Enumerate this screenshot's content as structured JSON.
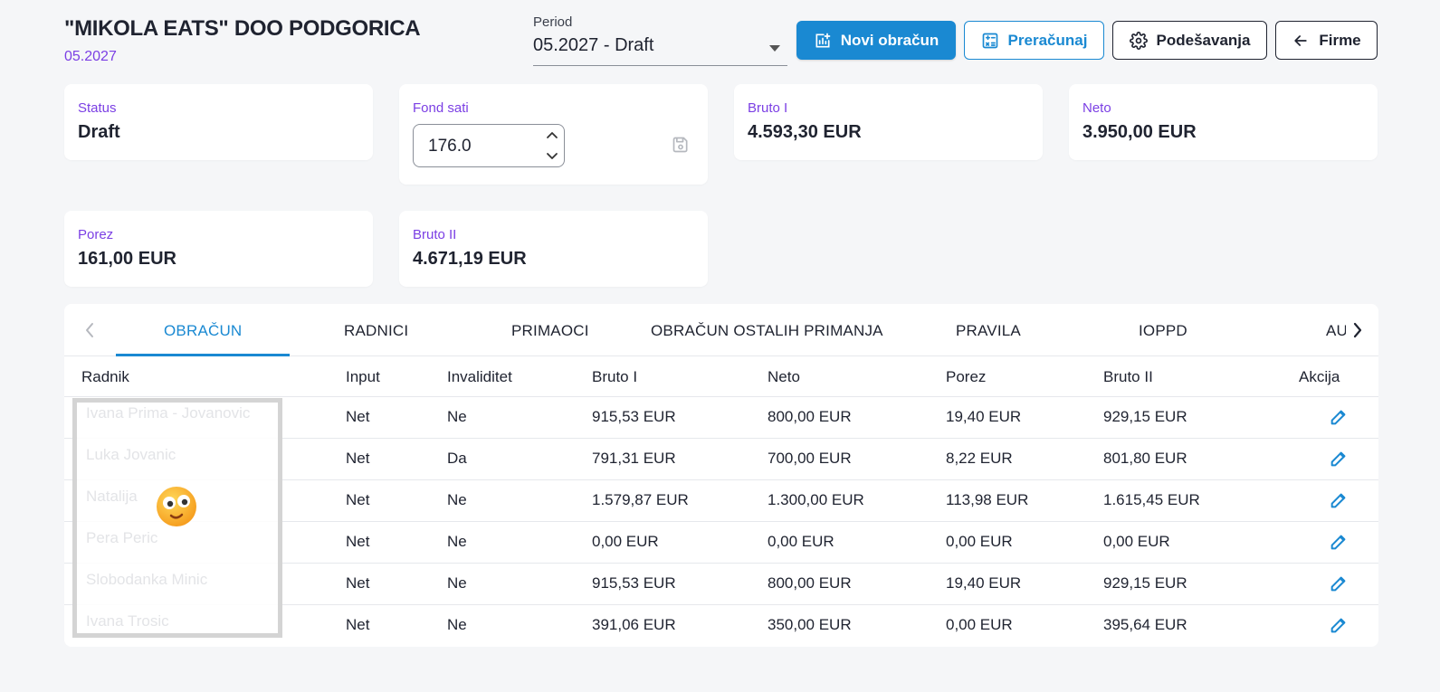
{
  "header": {
    "company": "\"MIKOLA EATS\" DOO PODGORICA",
    "period_sub": "05.2027"
  },
  "period_select": {
    "label": "Period",
    "value": "05.2027 - Draft"
  },
  "buttons": {
    "new_calc": "Novi obračun",
    "recalc": "Preračunaj",
    "settings": "Podešavanja",
    "back": "Firme"
  },
  "cards": {
    "status": {
      "label": "Status",
      "value": "Draft"
    },
    "fond_sati": {
      "label": "Fond sati",
      "value": "176.0"
    },
    "bruto1": {
      "label": "Bruto I",
      "value": "4.593,30 EUR"
    },
    "neto": {
      "label": "Neto",
      "value": "3.950,00 EUR"
    },
    "porez": {
      "label": "Porez",
      "value": "161,00 EUR"
    },
    "bruto2": {
      "label": "Bruto II",
      "value": "4.671,19 EUR"
    }
  },
  "tabs": [
    "OBRAČUN",
    "RADNICI",
    "PRIMAOCI",
    "OBRAČUN OSTALIH PRIMANJA",
    "PRAVILA",
    "IOPPD",
    "AU"
  ],
  "table": {
    "columns": [
      "Radnik",
      "Input",
      "Invaliditet",
      "Bruto I",
      "Neto",
      "Porez",
      "Bruto II",
      "Akcija"
    ],
    "rows": [
      {
        "input": "Net",
        "inv": "Ne",
        "b1": "915,53 EUR",
        "neto": "800,00 EUR",
        "porez": "19,40 EUR",
        "b2": "929,15 EUR"
      },
      {
        "input": "Net",
        "inv": "Da",
        "b1": "791,31 EUR",
        "neto": "700,00 EUR",
        "porez": "8,22 EUR",
        "b2": "801,80 EUR"
      },
      {
        "input": "Net",
        "inv": "Ne",
        "b1": "1.579,87 EUR",
        "neto": "1.300,00 EUR",
        "porez": "113,98 EUR",
        "b2": "1.615,45 EUR"
      },
      {
        "input": "Net",
        "inv": "Ne",
        "b1": "0,00 EUR",
        "neto": "0,00 EUR",
        "porez": "0,00 EUR",
        "b2": "0,00 EUR"
      },
      {
        "input": "Net",
        "inv": "Ne",
        "b1": "915,53 EUR",
        "neto": "800,00 EUR",
        "porez": "19,40 EUR",
        "b2": "929,15 EUR"
      },
      {
        "input": "Net",
        "inv": "Ne",
        "b1": "391,06 EUR",
        "neto": "350,00 EUR",
        "porez": "0,00 EUR",
        "b2": "395,64 EUR"
      }
    ]
  },
  "redacted_names": [
    "Ivana Prima - Jovanovic",
    "Luka Jovanic",
    "Natalija",
    "Pera Peric",
    "Slobodanka Minic",
    "Ivana Trosic"
  ],
  "colors": {
    "accent": "#1a89d2",
    "label": "#7b3fe4",
    "text": "#1f2330"
  },
  "icons": {
    "new_calc": "chart-plus-icon",
    "recalc": "calculator-icon",
    "settings": "gear-icon",
    "back": "arrow-left-icon",
    "edit": "pencil-icon",
    "save": "floppy-disk-icon"
  }
}
